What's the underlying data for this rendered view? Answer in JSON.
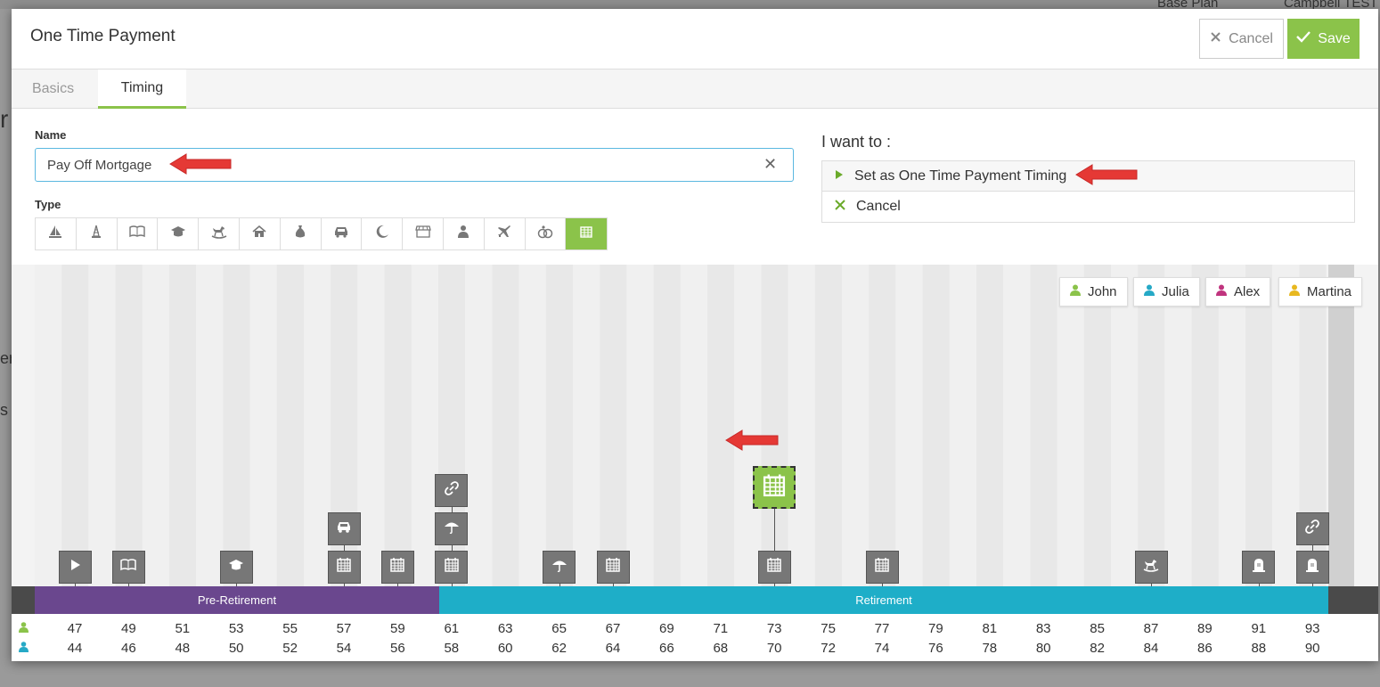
{
  "background": {
    "top_item1": "Base Plan",
    "top_item2": "Campbell TEST",
    "left_letters": [
      "r",
      "er",
      "s"
    ]
  },
  "modal": {
    "title": "One Time Payment"
  },
  "header": {
    "cancel_label": "Cancel",
    "save_label": "Save"
  },
  "tabs": [
    {
      "label": "Basics",
      "active": false
    },
    {
      "label": "Timing",
      "active": true
    }
  ],
  "form": {
    "name_label": "Name",
    "name_value": "Pay Off Mortgage",
    "type_label": "Type",
    "types": [
      "sailboat-icon",
      "cake-icon",
      "book-icon",
      "graduation-cap-icon",
      "rocking-horse-icon",
      "home-icon",
      "money-bag-icon",
      "car-icon",
      "moon-icon",
      "store-icon",
      "person-icon",
      "plane-icon",
      "rings-icon",
      "calendar-icon"
    ],
    "active_type": "calendar-icon"
  },
  "actions": {
    "heading": "I want to :",
    "items": [
      {
        "label": "Set as One Time Payment Timing",
        "icon": "play-icon"
      },
      {
        "label": "Cancel",
        "icon": "x-icon"
      }
    ]
  },
  "people": [
    {
      "name": "John",
      "color": "#8bc34a"
    },
    {
      "name": "Julia",
      "color": "#26a9c6"
    },
    {
      "name": "Alex",
      "color": "#c0347e"
    },
    {
      "name": "Martina",
      "color": "#e8b820"
    }
  ],
  "phases": [
    {
      "label": "Pre-Retirement",
      "color": "#6a478e"
    },
    {
      "label": "Retirement",
      "color": "#1eaec8"
    }
  ],
  "ages": {
    "john": [
      "47",
      "49",
      "51",
      "53",
      "55",
      "57",
      "59",
      "61",
      "63",
      "65",
      "67",
      "69",
      "71",
      "73",
      "75",
      "77",
      "79",
      "81",
      "83",
      "85",
      "87",
      "89",
      "91",
      "93"
    ],
    "julia": [
      "44",
      "46",
      "48",
      "50",
      "52",
      "54",
      "56",
      "58",
      "60",
      "62",
      "64",
      "66",
      "68",
      "70",
      "72",
      "74",
      "76",
      "78",
      "80",
      "82",
      "84",
      "86",
      "88",
      "90"
    ]
  },
  "events": [
    {
      "age_index": 0,
      "icons": [
        "play-icon"
      ]
    },
    {
      "age_index": 1,
      "icons": [
        "book-icon"
      ]
    },
    {
      "age_index": 3,
      "icons": [
        "graduation-cap-icon"
      ]
    },
    {
      "age_index": 5,
      "icons": [
        "calendar-icon",
        "car-icon"
      ]
    },
    {
      "age_index": 6,
      "icons": [
        "calendar-icon"
      ]
    },
    {
      "age_index": 7,
      "icons": [
        "calendar-icon",
        "umbrella-icon",
        "link-icon"
      ]
    },
    {
      "age_index": 9,
      "icons": [
        "umbrella-icon"
      ]
    },
    {
      "age_index": 10,
      "icons": [
        "calendar-icon"
      ]
    },
    {
      "age_index": 13,
      "icons": [
        "calendar-icon"
      ]
    },
    {
      "age_index": 15,
      "icons": [
        "calendar-icon"
      ]
    },
    {
      "age_index": 20,
      "icons": [
        "rocking-horse-icon"
      ]
    },
    {
      "age_index": 22,
      "icons": [
        "tombstone-icon"
      ]
    },
    {
      "age_index": 23,
      "icons": [
        "tombstone-icon",
        "link-icon"
      ]
    }
  ],
  "selected_event": {
    "age_index": 13,
    "icon": "calendar-icon"
  }
}
